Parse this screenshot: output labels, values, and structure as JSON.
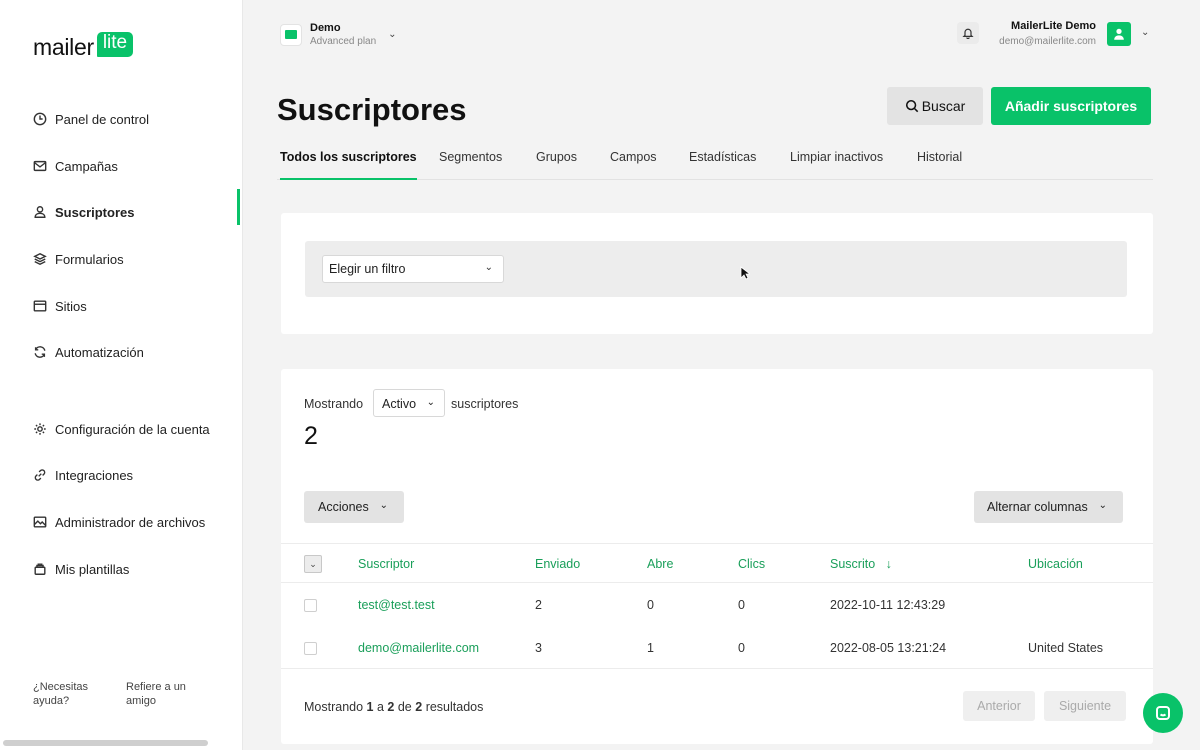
{
  "brand": {
    "word": "mailer",
    "badge": "lite",
    "accent": "#09c269"
  },
  "sidebar": {
    "items": [
      {
        "label": "Panel de control",
        "icon": "clock-icon"
      },
      {
        "label": "Campañas",
        "icon": "envelope-icon"
      },
      {
        "label": "Suscriptores",
        "icon": "user-icon",
        "active": true
      },
      {
        "label": "Formularios",
        "icon": "layers-icon"
      },
      {
        "label": "Sitios",
        "icon": "browser-icon"
      },
      {
        "label": "Automatización",
        "icon": "refresh-icon"
      },
      {
        "label": "Configuración de la cuenta",
        "icon": "gear-icon"
      },
      {
        "label": "Integraciones",
        "icon": "link-icon"
      },
      {
        "label": "Administrador de archivos",
        "icon": "image-icon"
      },
      {
        "label": "Mis plantillas",
        "icon": "template-icon"
      }
    ],
    "help": "¿Necesitas ayuda?",
    "refer": "Refiere a un amigo"
  },
  "header": {
    "account_name": "Demo",
    "account_plan": "Advanced plan",
    "user_name": "MailerLite Demo",
    "user_email": "demo@mailerlite.com"
  },
  "page": {
    "title": "Suscriptores",
    "search_label": "Buscar",
    "add_label": "Añadir suscriptores"
  },
  "tabs": [
    "Todos los suscriptores",
    "Segmentos",
    "Grupos",
    "Campos",
    "Estadísticas",
    "Limpiar inactivos",
    "Historial"
  ],
  "filter": {
    "select_value": "Elegir un filtro"
  },
  "subscribers": {
    "showing_label": "Mostrando",
    "status_value": "Activo",
    "suffix_label": "suscriptores",
    "count": "2",
    "actions_label": "Acciones",
    "toggle_columns_label": "Alternar columnas",
    "columns": [
      "Suscriptor",
      "Enviado",
      "Abre",
      "Clics",
      "Suscrito",
      "Ubicación"
    ],
    "rows": [
      {
        "email": "test@test.test",
        "sent": "2",
        "opens": "0",
        "clicks": "0",
        "subscribed": "2022-10-11 12:43:29",
        "location": ""
      },
      {
        "email": "demo@mailerlite.com",
        "sent": "3",
        "opens": "1",
        "clicks": "0",
        "subscribed": "2022-08-05 13:21:24",
        "location": "United States"
      }
    ],
    "footer": {
      "prefix": "Mostrando",
      "from": "1",
      "a": "a",
      "to": "2",
      "de": "de",
      "total": "2",
      "suffix": "resultados"
    },
    "prev_label": "Anterior",
    "next_label": "Siguiente"
  }
}
